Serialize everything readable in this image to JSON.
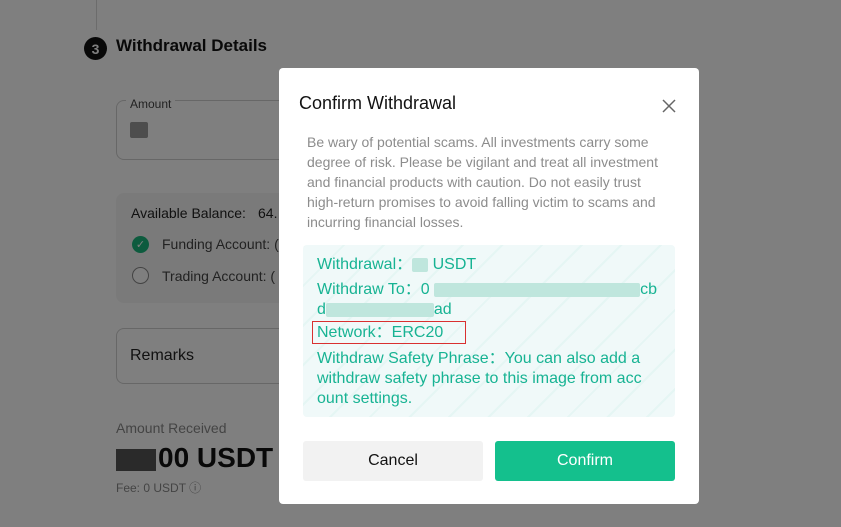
{
  "background": {
    "step_number": "3",
    "step_title": "Withdrawal Details",
    "amount_label": "Amount",
    "available_balance_label": "Available Balance:",
    "available_balance_value": "64.",
    "funding_account_label": "Funding Account: (",
    "trading_account_label": "Trading Account: (",
    "remarks_label": "Remarks",
    "amount_received_label": "Amount Received",
    "amount_received_value": "00 USDT",
    "fee_label": "Fee: 0 USDT"
  },
  "modal": {
    "title": "Confirm Withdrawal",
    "warning": "Be wary of potential scams. All investments carry some degree of risk. Please be vigilant and treat all investment and financial products with caution. Do not easily trust high-return promises to avoid falling victim to scams and incurring financial losses.",
    "withdrawal_label": "Withdrawal：",
    "withdrawal_currency": " USDT",
    "withdraw_to_label": "Withdraw To：",
    "address_tail_1": "cb",
    "address_tail_2": "ad",
    "network_label": "Network：ERC20",
    "safety_phrase_line1": "Withdraw Safety Phrase：You can also add a",
    "safety_phrase_line2": "withdraw safety phrase to this image from acc",
    "safety_phrase_line3": "ount settings.",
    "cancel_label": "Cancel",
    "confirm_label": "Confirm"
  },
  "colors": {
    "accent": "#14c08d",
    "info_text": "#17b393",
    "highlight": "#d93030"
  }
}
